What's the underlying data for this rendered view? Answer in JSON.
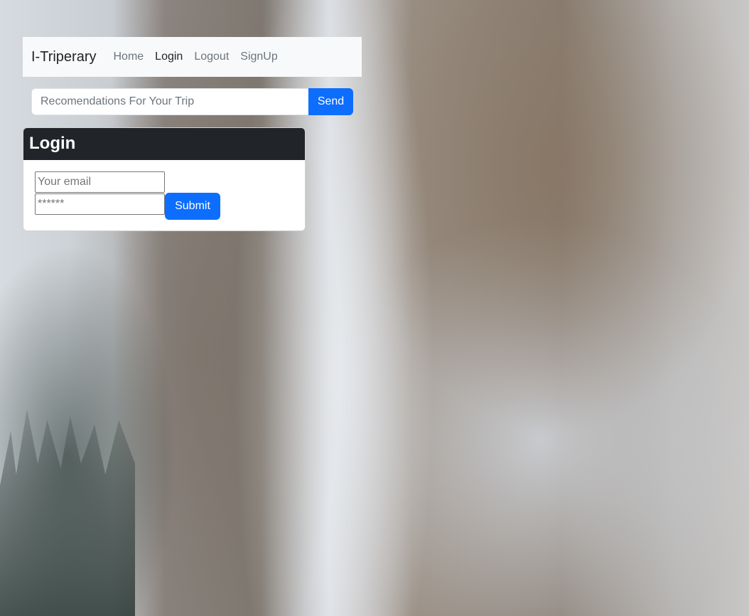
{
  "navbar": {
    "brand": "I-Triperary",
    "links": [
      {
        "label": "Home"
      },
      {
        "label": "Login"
      },
      {
        "label": "Logout"
      },
      {
        "label": "SignUp"
      }
    ]
  },
  "search": {
    "placeholder": "Recomendations For Your Trip",
    "send_label": "Send"
  },
  "login_card": {
    "title": "Login",
    "email_placeholder": "Your email",
    "password_placeholder": "******",
    "submit_label": "Submit"
  },
  "colors": {
    "primary": "#0d6efd",
    "header_dark": "#212529",
    "navbar_bg": "#f8f9fa"
  }
}
